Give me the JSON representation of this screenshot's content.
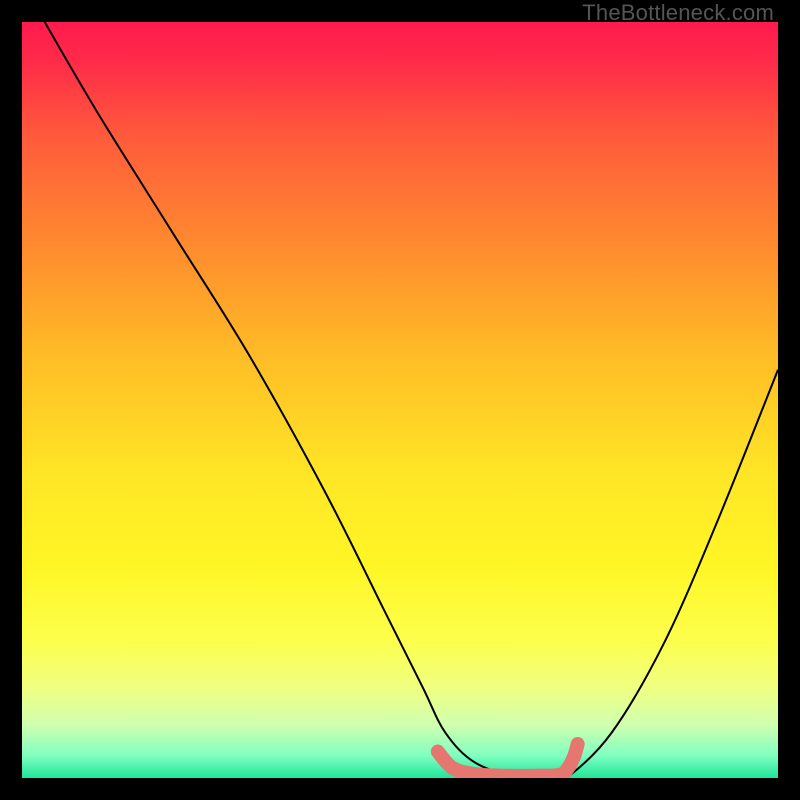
{
  "watermark": "TheBottleneck.com",
  "gradient": {
    "stops": [
      {
        "offset": 0.0,
        "color": "#ff1a4d"
      },
      {
        "offset": 0.05,
        "color": "#ff2a49"
      },
      {
        "offset": 0.15,
        "color": "#ff5a3c"
      },
      {
        "offset": 0.3,
        "color": "#ff8c2e"
      },
      {
        "offset": 0.45,
        "color": "#ffbf26"
      },
      {
        "offset": 0.6,
        "color": "#ffe626"
      },
      {
        "offset": 0.72,
        "color": "#fff626"
      },
      {
        "offset": 0.82,
        "color": "#fcff4d"
      },
      {
        "offset": 0.88,
        "color": "#f0ff80"
      },
      {
        "offset": 0.93,
        "color": "#d0ffb0"
      },
      {
        "offset": 0.97,
        "color": "#80ffc0"
      },
      {
        "offset": 1.0,
        "color": "#20e59a"
      }
    ]
  },
  "chart_data": {
    "type": "line",
    "title": "",
    "xlabel": "",
    "ylabel": "",
    "xlim": [
      0,
      100
    ],
    "ylim": [
      0,
      100
    ],
    "series": [
      {
        "name": "curve",
        "x": [
          3,
          10,
          20,
          30,
          40,
          48,
          53,
          56,
          60,
          66,
          70,
          72,
          78,
          85,
          92,
          100
        ],
        "y": [
          100,
          88,
          72,
          56,
          38,
          22,
          12,
          6,
          2,
          0,
          0,
          0,
          6,
          18,
          34,
          54
        ]
      }
    ],
    "highlight": {
      "name": "bottom-zone",
      "color": "#e57770",
      "x": [
        55,
        57,
        60,
        64,
        68,
        71,
        72,
        73,
        73.5
      ],
      "y": [
        3.5,
        1.3,
        0.5,
        0.3,
        0.3,
        0.4,
        1.0,
        2.8,
        4.5
      ]
    }
  }
}
